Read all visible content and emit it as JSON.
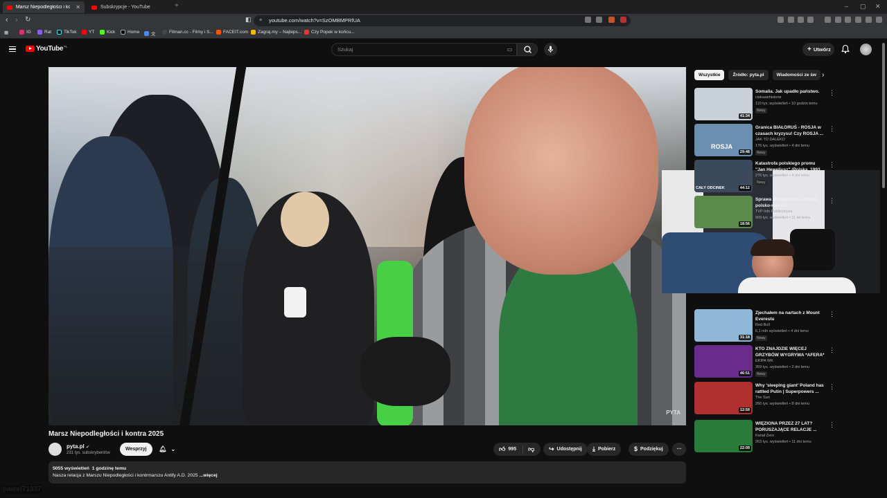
{
  "browser": {
    "tabs": [
      {
        "label": "Marsz Niepodległości i kontr",
        "active": true
      },
      {
        "label": "Subskrypcje - YouTube",
        "active": false
      }
    ],
    "url": "youtube.com/watch?v=SzOMBMPRfUA",
    "bookmarks": [
      "IG",
      "Rat",
      "TikTok",
      "YT",
      "Kick",
      "Home",
      "Filman.cc - Filmy i S...",
      "FACEIT.com",
      "Zagraj.my – Najleps...",
      "Czy Popek w końcu..."
    ]
  },
  "youtube": {
    "logo": "YouTube",
    "logo_region": "PL",
    "search_placeholder": "Szukaj",
    "create_label": "Utwórz"
  },
  "video": {
    "title": "Marsz Niepodległości i kontra 2025",
    "channel": "pyta.pl",
    "subscribers": "231 tys. subskrybentów",
    "support_label": "Wesprzyj",
    "likes": "995",
    "share_label": "Udostępnij",
    "download_label": "Pobierz",
    "thanks_label": "Podziękuj",
    "views": "5055 wyświetleń",
    "age": "1 godzinę temu",
    "description": "Nasza relacja z Marszu Niepodległości i kontrmarszu Antify A.D. 2025",
    "more_label": "...więcej",
    "watermark": "PYTA"
  },
  "sidebar": {
    "chips": [
      "Wszystkie",
      "Źródło: pyta.pl",
      "Wiadomości ze św"
    ],
    "recommendations": [
      {
        "title": "Somalia. Jak upadło państwo.",
        "channel": "ciekawehistorie",
        "meta": "110 tys. wyświetleń • 10 godzin temu",
        "badge": "Nowy",
        "duration": "41:34",
        "color": "#c9d1d8"
      },
      {
        "title": "Granica BIAŁORUŚ - ROSJA w czasach kryzysu! Czy ROSJA ...",
        "channel": "JAK TO DALEKO",
        "meta": "176 tys. wyświetleń • 4 dni temu",
        "badge": "Nowy",
        "duration": "29:48",
        "color": "#6c8fb0"
      },
      {
        "title": "Katastrofa polskiego promu \"Jan Heweliusz\" (Polska, 1993",
        "channel": "",
        "meta": "276 tys. wyświetleń • 4 dni temu",
        "badge": "Nowy",
        "duration": "44:12",
        "color": "#3a4a5c"
      },
      {
        "title": "Sprawa dla reportera - Wojna polsko-romska",
        "channel": "TVP Info Publicystyka",
        "meta": "909 tys. wyświetleń • 11 lat temu",
        "badge": "",
        "duration": "18:56",
        "color": "#5b8a4a"
      },
      {
        "title": "Zjechałem na nartach z Mount Everestu",
        "channel": "Red Bull",
        "meta": "6,1 mln wyświetleń • 4 dni temu",
        "badge": "Nowy",
        "duration": "31:18",
        "color": "#8fb7d8"
      },
      {
        "title": "KTO ZNAJDZIE WIĘCEJ GRZYBÓW WYGRYWA *AFERA*",
        "channel": "EKIPA WK",
        "meta": "359 tys. wyświetleń • 2 dni temu",
        "badge": "Nowy",
        "duration": "46:51",
        "color": "#6a2c8a"
      },
      {
        "title": "Why 'sleeping giant' Poland has rattled Putin | Superpowers ...",
        "channel": "The Sun",
        "meta": "260 tys. wyświetleń • 8 dni temu",
        "badge": "",
        "duration": "12:59",
        "color": "#b03030"
      },
      {
        "title": "WIĘZIONA PRZEZ 27 LAT? PORUSZAJĄCE RELACJE ...",
        "channel": "Kanał Zero",
        "meta": "263 tys. wyświetleń • 11 dni temu",
        "badge": "",
        "duration": "22:09",
        "color": "#2a7a3a"
      }
    ],
    "katastrofa_label": "CAŁY ODCINEK",
    "rosja_label": "ROSJA"
  },
  "overlay": {
    "chat_name": "pawel71337"
  }
}
